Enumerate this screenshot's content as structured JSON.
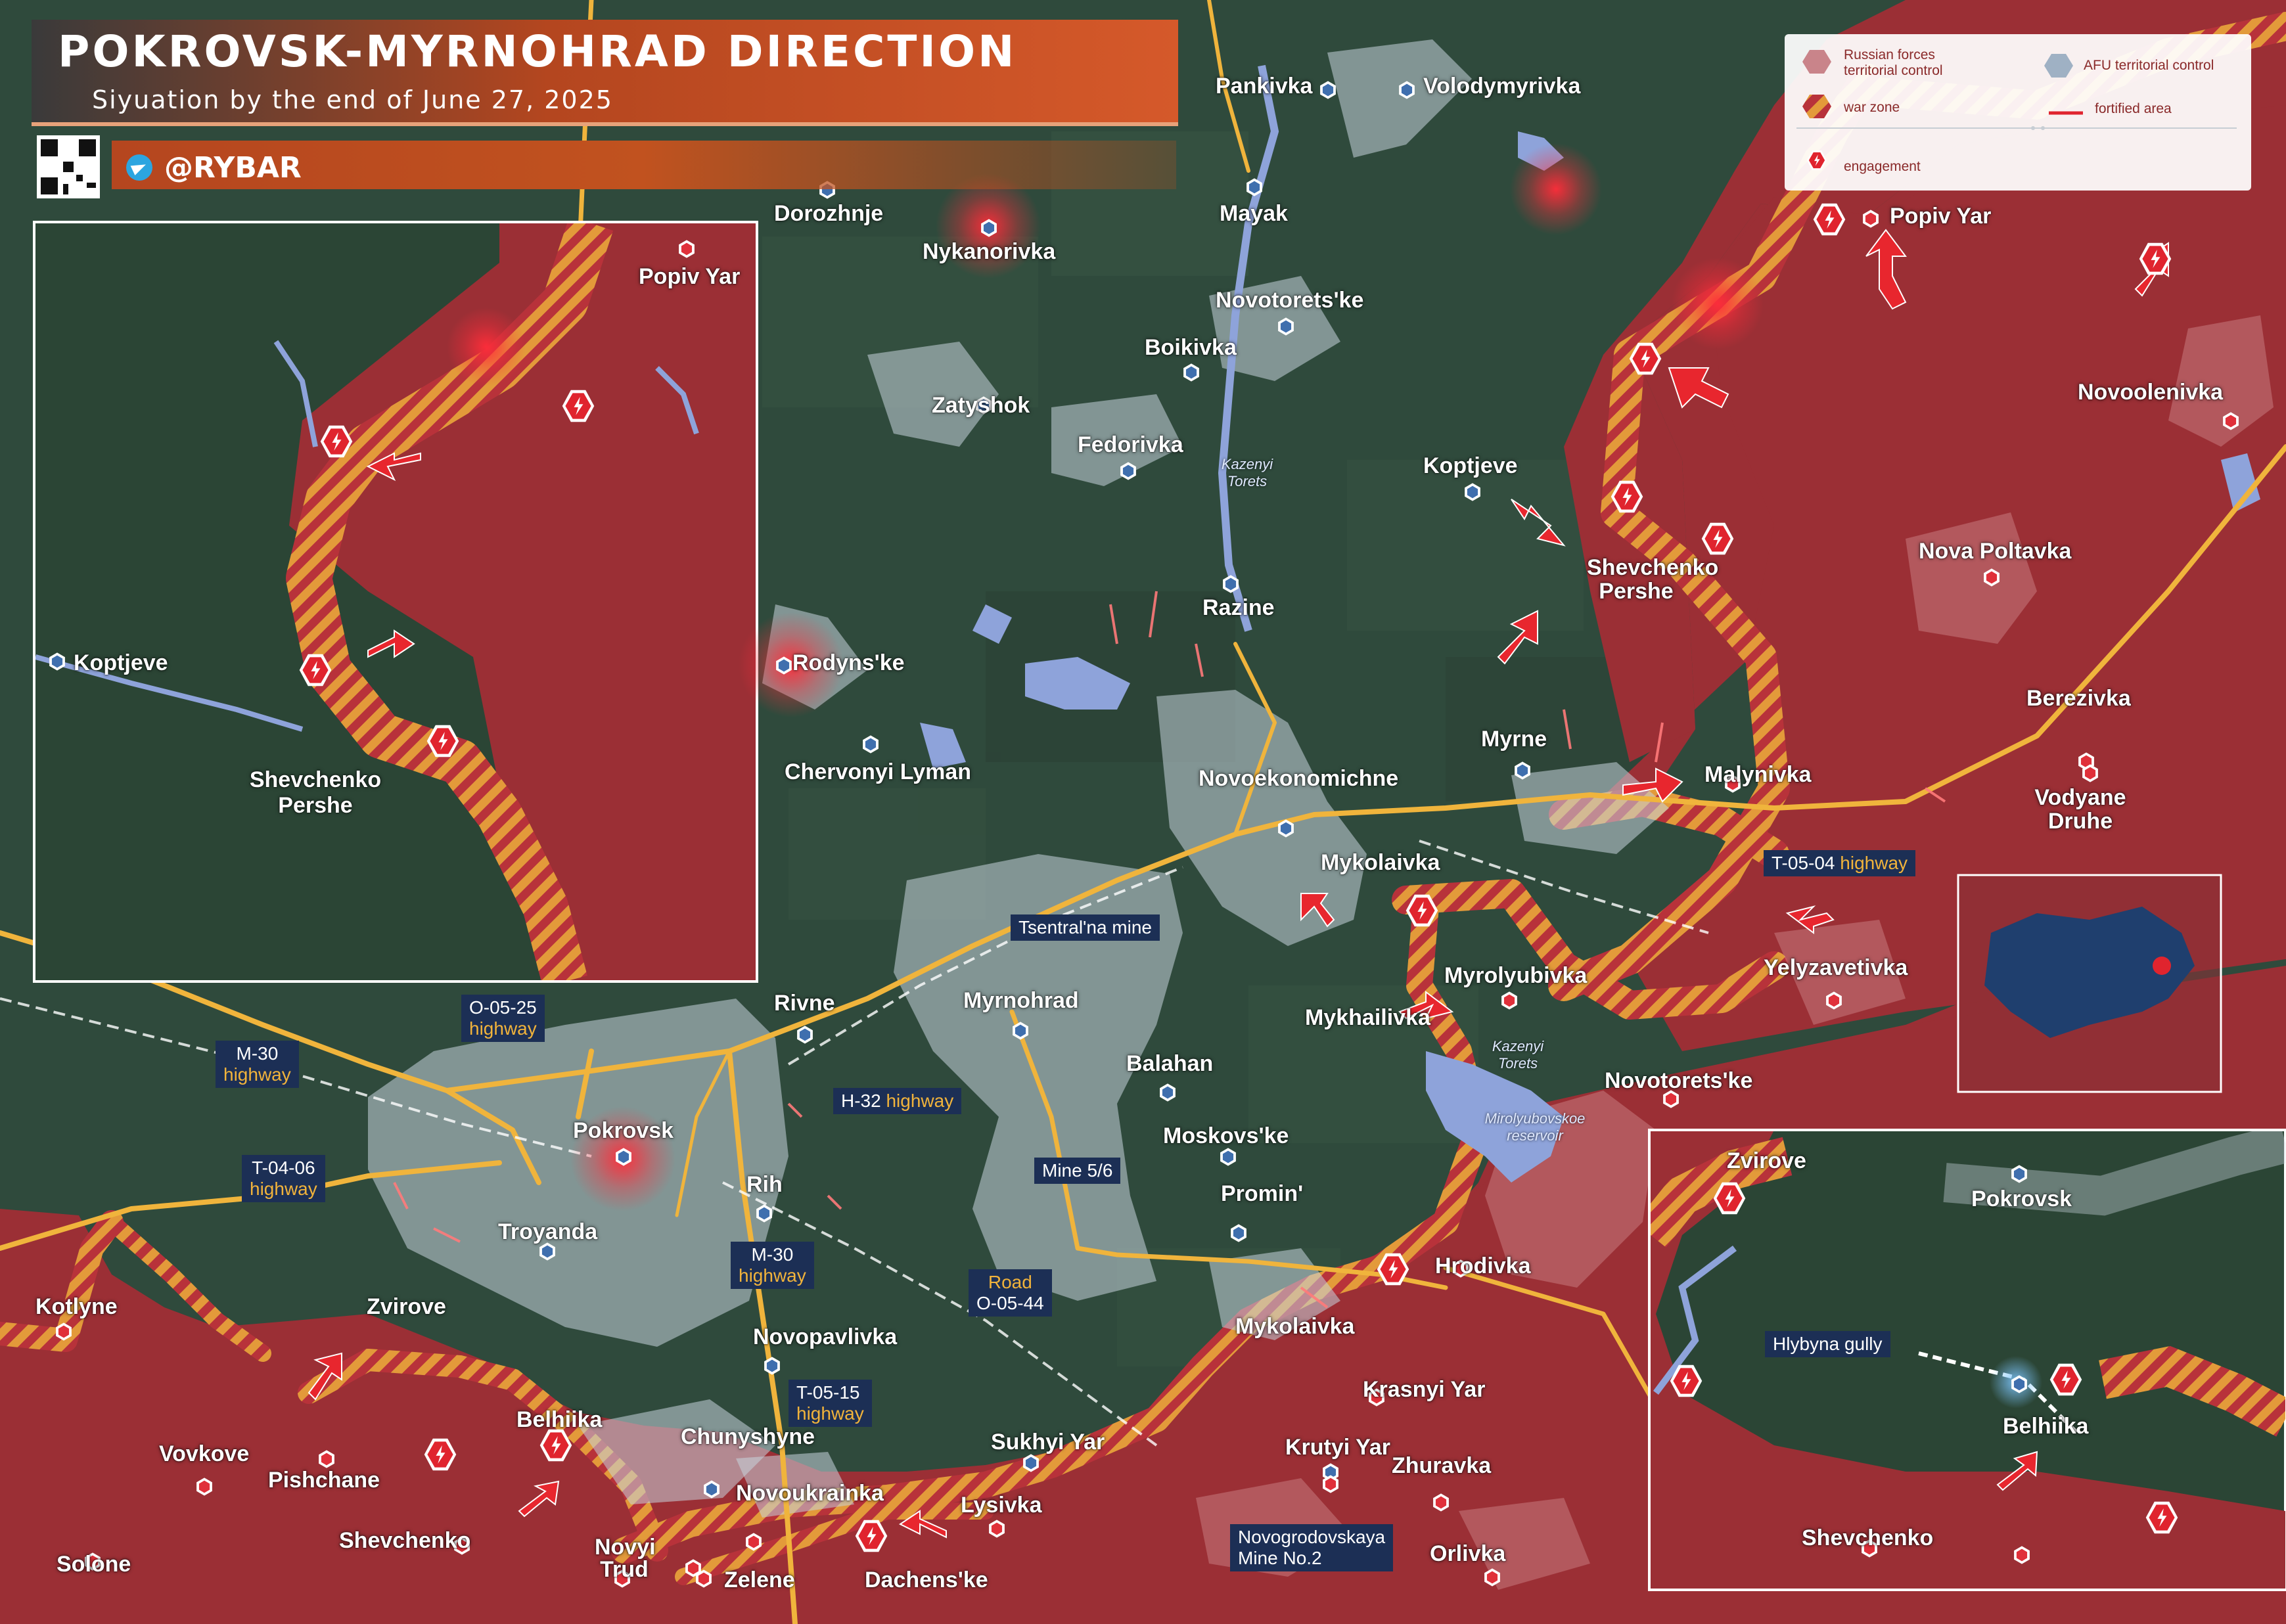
{
  "header": {
    "title": "POKROVSK-MYRNOHRAD DIRECTION",
    "subtitle": "Siyuation by the end of June 27, 2025",
    "brand": "@RYBAR"
  },
  "legend": {
    "russian_control": "Russian forces territorial control",
    "afu_control": "AFU territorial control",
    "war_zone": "war zone",
    "fortified_area": "fortified area",
    "engagement": "engagement"
  },
  "colors": {
    "russian_control": "#9b2f35",
    "afu_control": "#c7d3dc",
    "war_zone_a": "#e39a3a",
    "war_zone_b": "#b8323a",
    "engagement": "#e0242e",
    "road": "#f0b43c",
    "water": "#8ea3da",
    "terrain": "#2f4a3c",
    "title_orange": "#d5592a",
    "highway_box": "#1c2f55"
  },
  "places": {
    "pankivka": "Pankivka",
    "volodymyrivka": "Volodymyrivka",
    "dorozhnje": "Dorozhnje",
    "nykanorivka": "Nykanorivka",
    "mayak": "Mayak",
    "popiv_yar": "Popiv Yar",
    "novotoretske_n": "Novotorets'ke",
    "boikivka": "Boikivka",
    "zatyshok": "Zatyshok",
    "fedorivka": "Fedorivka",
    "koptjeve": "Koptjeve",
    "shevchenko_pershe": "Shevchenko Pershe",
    "novoolenivka": "Novoolenivka",
    "razine": "Razine",
    "nova_poltavka": "Nova Poltavka",
    "rodynske": "Rodyns'ke",
    "berezivka": "Berezivka",
    "chervonyi_lyman": "Chervonyi Lyman",
    "myrne": "Myrne",
    "novoekonomichne": "Novoekonomichne",
    "malynivka": "Malynivka",
    "vodyane_druhe": "Vodyane Druhe",
    "mykolaivka_n": "Mykolaivka",
    "myrolyubivka": "Myrolyubivka",
    "yelyzavetivka": "Yelyzavetivka",
    "mykhailivka": "Mykhailivka",
    "rivne": "Rivne",
    "myrnohrad": "Myrnohrad",
    "balahan": "Balahan",
    "novotoretske_s": "Novotorets'ke",
    "pokrovsk": "Pokrovsk",
    "moskovske": "Moskovs'ke",
    "rih": "Rih",
    "promin": "Promin'",
    "troyanda": "Troyanda",
    "hrodivka": "Hrodivka",
    "kotlyne": "Kotlyne",
    "zvirove": "Zvirove",
    "mykolaivka_s": "Mykolaivka",
    "novopavlivka": "Novopavlivka",
    "krasnyi_yar": "Krasnyi Yar",
    "belhiika": "Belhiika",
    "chunyshyne": "Chunyshyne",
    "sukhyi_yar": "Sukhyi Yar",
    "krutyi_yar": "Krutyi Yar",
    "zhuravka": "Zhuravka",
    "vovkove": "Vovkove",
    "pishchane": "Pishchane",
    "novoukrainka": "Novoukrainka",
    "lysivka": "Lysivka",
    "shevchenko": "Shevchenko",
    "solone": "Solone",
    "novyi_trud": "Novyi Trud",
    "zelene": "Zelene",
    "dachenske": "Dachens'ke",
    "orlivka": "Orlivka"
  },
  "rivers": {
    "kazenyi_torets_n": "Kazenyi Torets",
    "kazenyi_torets_s": "Kazenyi Torets",
    "mirolyubovskoe": "Mirolyubovskoe reservoir"
  },
  "roads": {
    "o0525_code": "O-05-25",
    "o0525_type": "highway",
    "m30_code": "M-30",
    "m30_type": "highway",
    "h32_code": "H-32",
    "h32_type": "highway",
    "t0406_code": "T-04-06",
    "t0406_type": "highway",
    "m30b_code": "M-30",
    "m30b_type": "highway",
    "t0515_code": "T-05-15",
    "t0515_type": "highway",
    "t0504_code": "T-05-04",
    "t0504_type": "highway",
    "road_o0544_a": "Road",
    "road_o0544_b": "O-05-44"
  },
  "features": {
    "tsentralna_mine": "Tsentral'na mine",
    "mine_56": "Mine 5/6",
    "novogrod_mine_a": "Novogrodovskaya",
    "novogrod_mine_b": "Mine No.2",
    "hlybyna_gully": "Hlybyna gully"
  },
  "inset_left": {
    "popiv_yar": "Popiv Yar",
    "koptjeve": "Koptjeve",
    "shevchenko_pershe_a": "Shevchenko",
    "shevchenko_pershe_b": "Pershe"
  },
  "inset_right": {
    "zvirove": "Zvirove",
    "pokrovsk": "Pokrovsk",
    "hlybyna_gully": "Hlybyna gully",
    "belhiika": "Belhiika",
    "shevchenko": "Shevchenko"
  }
}
